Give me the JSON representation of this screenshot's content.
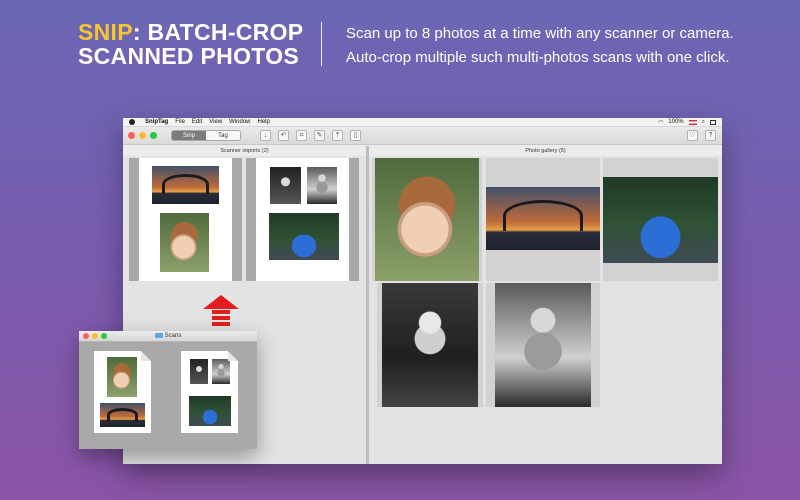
{
  "banner": {
    "title_accent": "SNIP",
    "title_rest": ": BATCH-CROP",
    "title_line2": "SCANNED PHOTOS",
    "desc_line1": "Scan up to 8 photos at a time with any scanner or camera.",
    "desc_line2": "Auto-crop multiple such multi-photos scans with one click."
  },
  "menubar": {
    "app_name": "SnipTag",
    "items": [
      "File",
      "Edit",
      "View",
      "Window",
      "Help"
    ],
    "battery": "100%"
  },
  "toolbar": {
    "modes": [
      "Snip",
      "Tag"
    ],
    "active_mode": "Snip",
    "tool_icons": [
      "download-icon",
      "undo-icon",
      "crop-icon",
      "pencil-icon",
      "export-icon",
      "trash-icon"
    ],
    "right_icons": [
      "heart-icon",
      "help-icon"
    ]
  },
  "scanner_imports": {
    "header": "Scanner imports (2)"
  },
  "photo_gallery": {
    "header": "Photo gallery (5)"
  },
  "finder": {
    "title": "Scans"
  },
  "colors": {
    "accent": "#f7c62d",
    "arrow": "#e01e1e",
    "background_top": "#6a67b4",
    "background_bottom": "#8b54a7"
  }
}
